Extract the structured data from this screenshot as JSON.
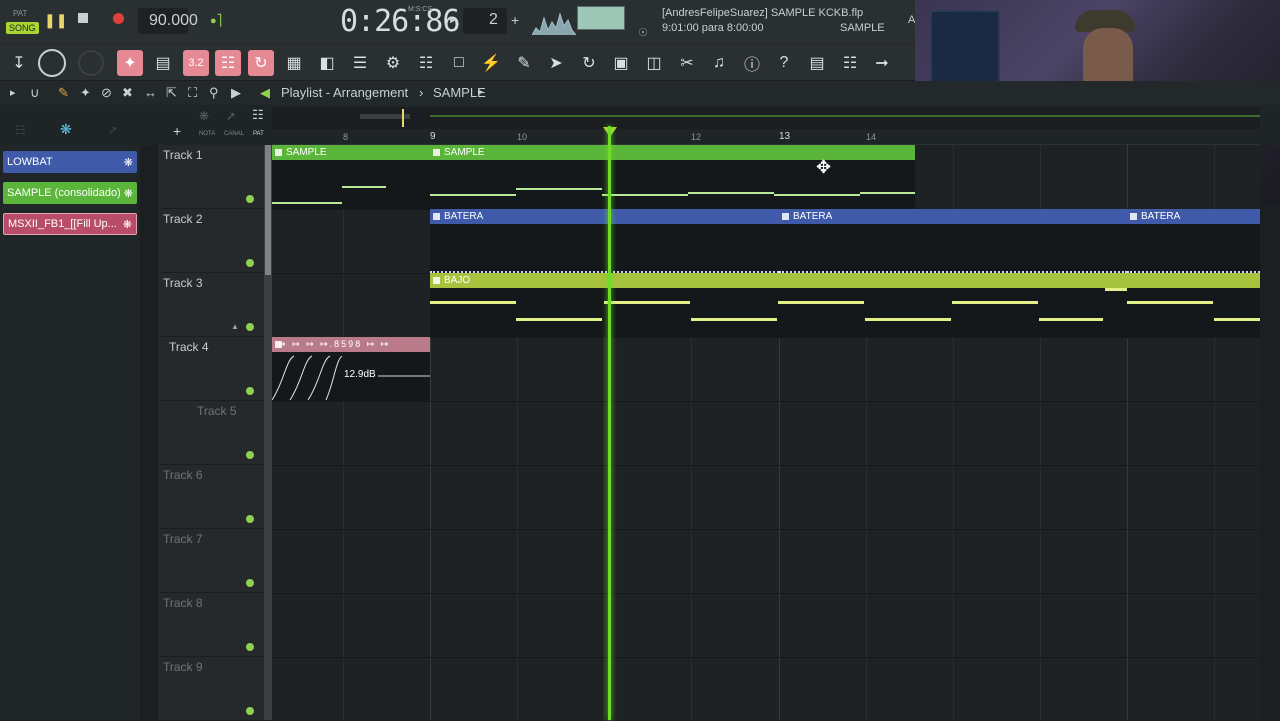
{
  "transport": {
    "mode_pat": "PAT",
    "mode_song": "SONG",
    "tempo": "90.000",
    "time": "0:26:86",
    "time_unit": "M:S:CS",
    "pattern_number": "2",
    "pattern_plus": "+",
    "project_title": "[AndresFelipeSuarez] SAMPLE KCKB.flp",
    "hint": "9:01:00 para 8:00:00",
    "current_pattern": "SAMPLE",
    "letter_a": "A"
  },
  "playlist": {
    "title": "Playlist - Arrangement",
    "pattern": "SAMPLE",
    "col_nota": "NOTA",
    "col_canal": "CANAL",
    "col_pat": "PAT",
    "add": "+"
  },
  "picker": [
    {
      "label": "LOWBAT",
      "color": "#3e5aa8"
    },
    {
      "label": "SAMPLE (consolidado)",
      "color": "#5bb53a"
    },
    {
      "label": "MSXII_FB1_[[Fill Up...",
      "color": "#b84d6a"
    }
  ],
  "ruler": [
    "8",
    "9",
    "10",
    "12",
    "13",
    "14"
  ],
  "tracks": [
    {
      "name": "Track 1"
    },
    {
      "name": "Track 2"
    },
    {
      "name": "Track 3"
    },
    {
      "name": "Track 4"
    },
    {
      "name": "Track 5"
    },
    {
      "name": "Track 6"
    },
    {
      "name": "Track 7"
    },
    {
      "name": "Track 8"
    },
    {
      "name": "Track 9"
    }
  ],
  "clips": {
    "sample": "SAMPLE",
    "batera": "BATERA",
    "bajo": "BAJO",
    "auto_label": ".8598",
    "auto_value": "12.9dB"
  },
  "colors": {
    "accent_green": "#6fdc2a",
    "sample": "#5bb53a",
    "batera": "#3e5aa8",
    "bajo": "#a7c23c",
    "auto": "#b97b8a"
  }
}
